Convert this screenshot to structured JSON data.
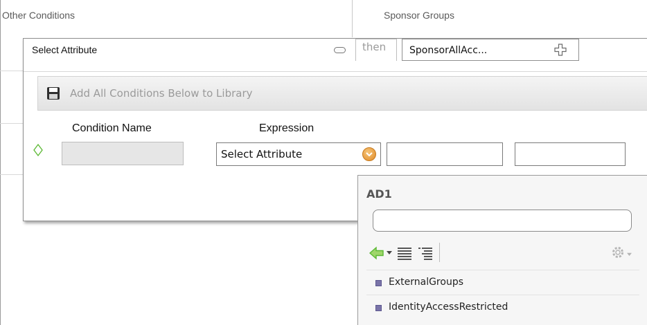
{
  "header": {
    "other_conditions": "Other Conditions",
    "sponsor_groups": "Sponsor Groups"
  },
  "rule": {
    "select_attribute_label": "Select Attribute",
    "then_label": "then",
    "sponsor_value": "SponsorAllAcc..."
  },
  "library": {
    "add_all_label": "Add All Conditions Below to Library"
  },
  "columns": {
    "condition_name": "Condition Name",
    "expression": "Expression"
  },
  "condition_row": {
    "name_value": "",
    "attribute_select": "Select Attribute",
    "operator_value": "",
    "value_value": ""
  },
  "picker": {
    "title": "AD1",
    "search_value": "",
    "items": [
      {
        "label": "ExternalGroups"
      },
      {
        "label": "IdentityAccessRestricted"
      }
    ]
  },
  "icons": {
    "minus": "minus-icon",
    "plus": "plus-icon",
    "save": "save-icon",
    "diamond": "diamond-icon",
    "dropdown": "chevron-down-icon",
    "search": "search-icon",
    "back": "back-arrow-icon",
    "list": "list-view-icon",
    "tree": "tree-view-icon",
    "gear": "gear-icon"
  },
  "colors": {
    "accent_green": "#5bb833",
    "accent_orange": "#e08a26",
    "bullet_purple": "#7a74a8"
  }
}
